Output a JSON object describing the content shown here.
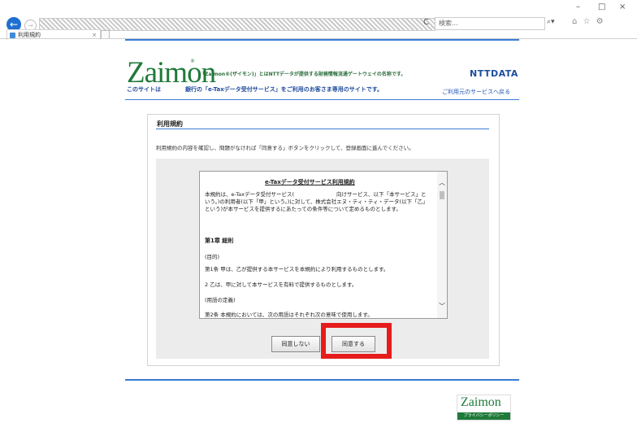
{
  "browser": {
    "search_placeholder": "検索...",
    "tab_title": "利用規約",
    "tab_close": "×",
    "refresh": "C",
    "search_icon": "search-icon",
    "window": {
      "minimize": "–",
      "maximize": "□",
      "close": "×"
    },
    "toolbar_icons": "⌂ ☆ ⚙"
  },
  "header": {
    "logo": "Zaimon",
    "logo_mark": "®",
    "tagline": "「Zaimon®(ザイモン)」とはNTTデータが提供する財務情報流通ゲートウェイの名称です。",
    "brand": "NTTDATA",
    "site_prefix": "このサイトは",
    "site_description": "銀行の「e-Taxデータ受付サービス」をご利用のお客さま専用のサイトです。",
    "return_link": "ご利用元のサービスへ戻る"
  },
  "terms": {
    "title": "利用規約",
    "instruction": "利用規約の内容を確認し、問題がなければ「同意する」ボタンをクリックして、登録画面に進んでください。",
    "doc_heading": "e-Taxデータ受付サービス利用規約",
    "doc_intro": "本規約は、e-Taxデータ受付サービス(　　　　　　　　向けサービス、以下「本サービス」という。)の利用者(以下「甲」という。)に対して、株式会社エヌ・ティ・ティ・データ(以下「乙」という)が本サービスを提供するにあたっての条件等について定めるものとします。",
    "chapter1": "第1章 総則",
    "purpose_heading": "(目的)",
    "article1": "第1条 甲は、乙が提供する本サービスを本規約により利用するものとします。",
    "article1_2": "2 乙は、甲に対して本サービスを有料で提供するものとします。",
    "definitions_heading": "(用語の定義)",
    "article2": "第2条 本規約においては、次の用語はそれぞれ次の意味で使用します。"
  },
  "buttons": {
    "disagree": "同意しない",
    "agree": "同意する"
  },
  "footer": {
    "logo": "Zaimon",
    "privacy": "プライバシーポリシー"
  },
  "colors": {
    "brand_green": "#1f7a3a",
    "rule_blue": "#3a7bd5",
    "highlight_red": "#e61c1c"
  }
}
